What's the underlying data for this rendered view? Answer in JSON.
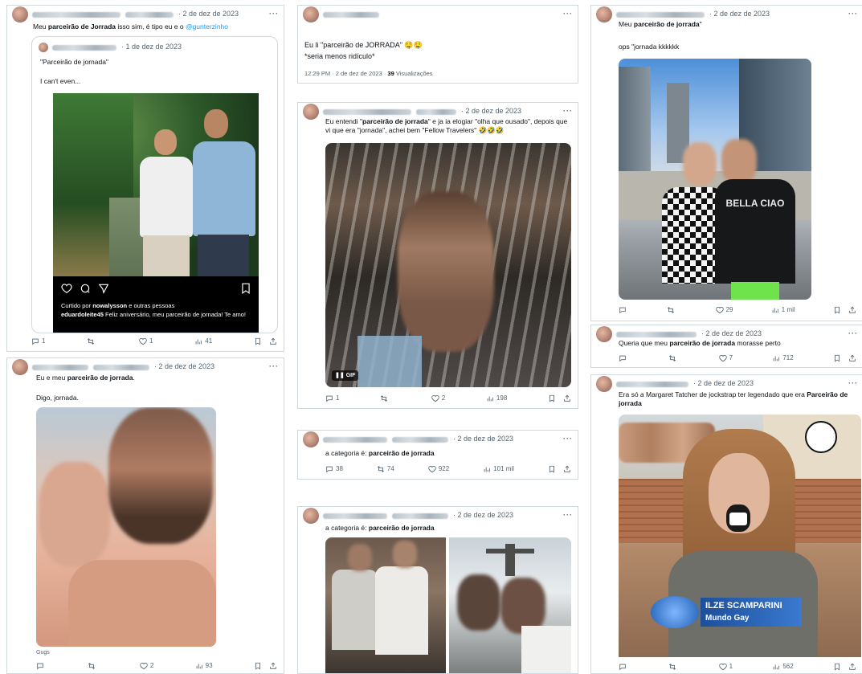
{
  "colors": {
    "link": "#1d9bf0",
    "border": "#cfd9de",
    "muted": "#536471",
    "text": "#0f1419"
  },
  "icons": {
    "reply": "speech-bubble-icon",
    "retweet": "retweet-arrows-icon",
    "like": "heart-icon",
    "views": "bar-chart-icon",
    "bookmark": "bookmark-icon",
    "share": "share-upload-icon",
    "more": "ellipsis-icon"
  },
  "tweets": {
    "t1": {
      "date": "· 2 de dez de 2023",
      "text_a": "Meu ",
      "text_bold": "parceirão de Jorrada",
      "text_b": " isso sim, é tipo eu e o ",
      "mention": "@gunterzinho",
      "quote": {
        "date": "· 1 de dez de 2023",
        "line1": "\"Parceirão de jornada\"",
        "line2": "I can't even...",
        "insta_liked": "Curtido por ",
        "insta_liked_user": "nowalysson",
        "insta_liked_rest": " e outras pessoas",
        "insta_caption_user": "eduardoleite45",
        "insta_caption": " Feliz aniversário, meu parceirão de jornada! Te amo!"
      },
      "stats": {
        "reply": "1",
        "retweet": "",
        "like": "1",
        "views": "41"
      }
    },
    "t2": {
      "date": "· 2 de dez de 2023",
      "text_a": "Eu e meu ",
      "text_bold": "parceirão de jorrada",
      "text_b": ".",
      "line2": "Digo, jornada.",
      "caption": "Gugs",
      "stats": {
        "reply": "",
        "retweet": "",
        "like": "2",
        "views": "93"
      }
    },
    "t3": {
      "line1": "Eu li \"parceirão de JORRADA\" 🤤🤤",
      "line2": "*seria menos ridículo*",
      "meta": "12:29 PM · 2 de dez de 2023 · ",
      "views_num": "39",
      "views_label": " Visualizações"
    },
    "t4": {
      "date": "· 2 de dez de 2023",
      "text_a": "Eu entendi \"",
      "text_bold": "parceirão de jorrada",
      "text_b": "\" e ja ia elogiar \"olha que ousado\", depois que vi que era \"jornada\", achei bem \"Fellow Travelers\" 🤣🤣🤣",
      "gif": "GIF",
      "stats": {
        "reply": "1",
        "retweet": "",
        "like": "2",
        "views": "198"
      }
    },
    "t5": {
      "date": "· 2 de dez de 2023",
      "text_a": "a categoria é: ",
      "text_bold": "parceirão de jorrada",
      "stats": {
        "reply": "38",
        "retweet": "74",
        "like": "922",
        "views": "101 mil"
      }
    },
    "t6": {
      "date": "· 2 de dez de 2023",
      "text_a": "a categoria é: ",
      "text_bold": "parceirão de jorrada"
    },
    "t7": {
      "date": "· 2 de dez de 2023",
      "text_a": "Meu ",
      "text_bold": "parceirão de jorrada",
      "text_b": "\"",
      "line2": "ops \"jornada kkkkkk",
      "shirt": "BELLA CIAO",
      "stats": {
        "reply": "",
        "retweet": "",
        "like": "29",
        "views": "1 mil"
      }
    },
    "t8": {
      "date": "· 2 de dez de 2023",
      "text_a": "Queria que meu ",
      "text_bold": "parceirão de jorrada",
      "text_b": " morasse perto",
      "stats": {
        "reply": "",
        "retweet": "",
        "like": "7",
        "views": "712"
      }
    },
    "t9": {
      "date": "· 2 de dez de 2023",
      "text_a": "Era só a Margaret Tatcher de jockstrap ter legendado que era ",
      "text_bold": "Parceirão de jorrada",
      "lower_third_name": "ILZE SCAMPARINI",
      "lower_third_sub": "Mundo Gay",
      "stats": {
        "reply": "",
        "retweet": "",
        "like": "1",
        "views": "562"
      }
    }
  }
}
